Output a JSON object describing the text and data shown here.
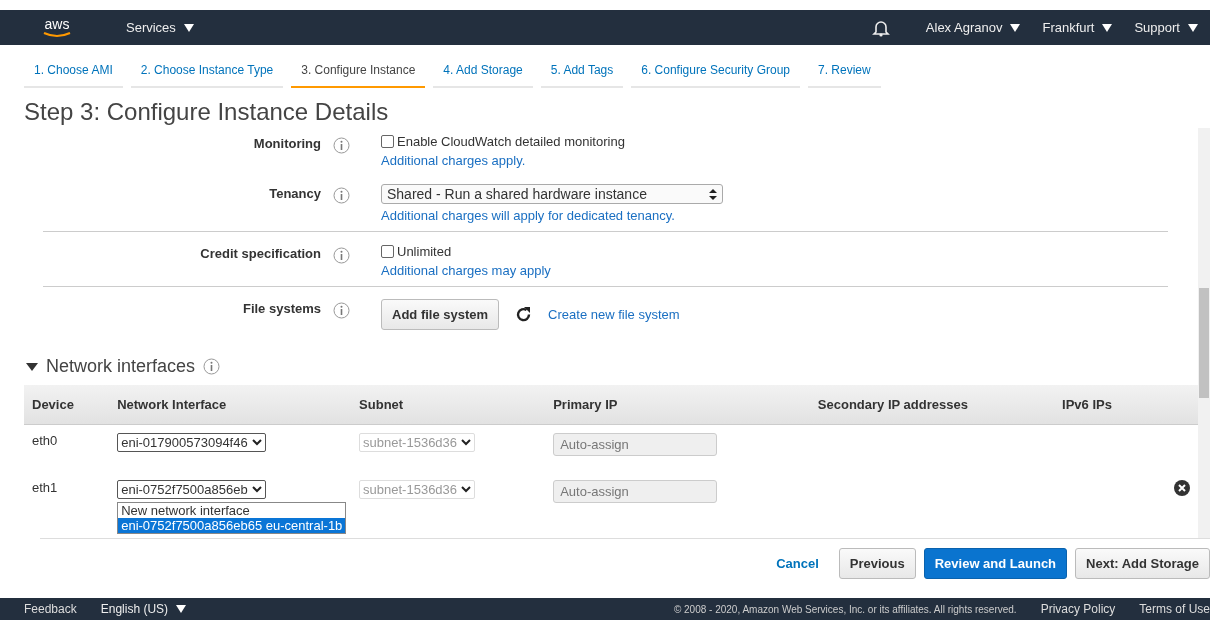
{
  "nav": {
    "logo": "aws",
    "left_menus": [
      "Services"
    ],
    "right_menus": [
      "Alex Agranov",
      "Frankfurt",
      "Support"
    ]
  },
  "steps": [
    {
      "label": "1. Choose AMI",
      "selected": false
    },
    {
      "label": "2. Choose Instance Type",
      "selected": false
    },
    {
      "label": "3. Configure Instance",
      "selected": true
    },
    {
      "label": "4. Add Storage",
      "selected": false
    },
    {
      "label": "5. Add Tags",
      "selected": false
    },
    {
      "label": "6. Configure Security Group",
      "selected": false
    },
    {
      "label": "7. Review",
      "selected": false
    }
  ],
  "heading": "Step 3: Configure Instance Details",
  "rows": [
    {
      "kind": "checkbox",
      "label": "Monitoring",
      "option": "Enable CloudWatch detailed monitoring",
      "checked": false,
      "note": "Additional charges apply."
    },
    {
      "kind": "select",
      "label": "Tenancy",
      "value": "Shared - Run a shared hardware instance",
      "note": "Additional charges will apply for dedicated tenancy."
    },
    {
      "kind": "checkbox",
      "label": "Credit specification",
      "option": "Unlimited",
      "checked": false,
      "note": "Additional charges may apply"
    },
    {
      "kind": "button",
      "label": "File systems",
      "button": "Add file system",
      "link": "Create new file system"
    }
  ],
  "network": {
    "title": "Network interfaces",
    "expanded": true,
    "columns": [
      "Device",
      "Network Interface",
      "Subnet",
      "Primary IP",
      "Secondary IP addresses",
      "IPv6 IPs"
    ],
    "rows": [
      {
        "device": "eth0",
        "interface": "eni-017900573094f46",
        "subnet": "subnet-1536d36",
        "primary_ip": "Auto-assign",
        "removable": false
      },
      {
        "device": "eth1",
        "interface": "eni-0752f7500a856eb",
        "subnet": "subnet-1536d36",
        "primary_ip": "Auto-assign",
        "removable": true,
        "open_options": [
          {
            "label": "New network interface",
            "selected": false
          },
          {
            "label": "eni-0752f7500a856eb65 eu-central-1b",
            "selected": true
          }
        ]
      }
    ]
  },
  "actions": [
    {
      "kind": "link",
      "label": "Cancel"
    },
    {
      "kind": "secondary",
      "label": "Previous"
    },
    {
      "kind": "primary",
      "label": "Review and Launch"
    },
    {
      "kind": "secondary",
      "label": "Next: Add Storage"
    }
  ],
  "footer": {
    "left": [
      "Feedback",
      "English (US)"
    ],
    "copyright": "© 2008 - 2020, Amazon Web Services, Inc. or its affiliates. All rights reserved.",
    "links": [
      "Privacy Policy",
      "Terms of Use"
    ]
  }
}
